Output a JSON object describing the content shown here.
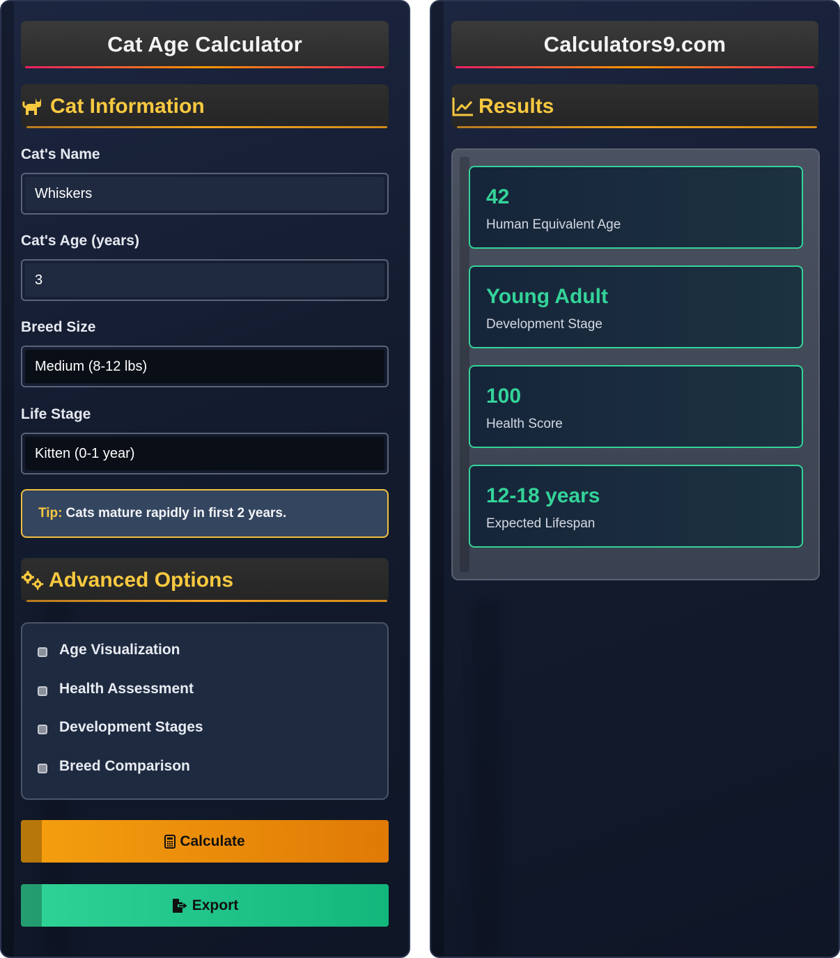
{
  "left": {
    "title": "Cat Age Calculator",
    "cat_info_heading": "Cat Information",
    "name_label": "Cat's Name",
    "name_value": "Whiskers",
    "age_label": "Cat's Age (years)",
    "age_value": "3",
    "breed_label": "Breed Size",
    "breed_value": "Medium (8-12 lbs)",
    "stage_label": "Life Stage",
    "stage_value": "Kitten (0-1 year)",
    "tip_key": "Tip:",
    "tip_text": "Cats mature rapidly in first 2 years.",
    "advanced_heading": "Advanced Options",
    "options": [
      {
        "label": "Age Visualization"
      },
      {
        "label": "Health Assessment"
      },
      {
        "label": "Development Stages"
      },
      {
        "label": "Breed Comparison"
      }
    ],
    "calculate_label": "Calculate",
    "export_label": "Export"
  },
  "right": {
    "title": "Calculators9.com",
    "results_heading": "Results",
    "cards": [
      {
        "value": "42",
        "label": "Human Equivalent Age"
      },
      {
        "value": "Young Adult",
        "label": "Development Stage"
      },
      {
        "value": "100",
        "label": "Health Score"
      },
      {
        "value": "12-18 years",
        "label": "Expected Lifespan"
      }
    ]
  },
  "icons": {
    "cat_info": "cat-icon",
    "advanced": "cogs-icon",
    "results": "chart-line-icon",
    "calculate": "calculator-icon",
    "export": "file-export-icon"
  },
  "colors": {
    "accent_yellow": "#f8c940",
    "accent_green": "#34d399",
    "calculate_orange": "#f5a00f",
    "export_green": "#1fc487"
  }
}
